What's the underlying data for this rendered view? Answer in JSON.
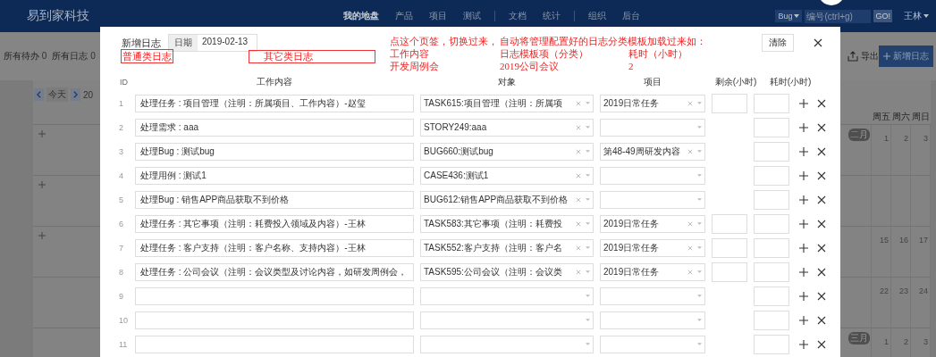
{
  "nav": {
    "logo": "易到家科技",
    "menu_groups": [
      [
        {
          "label": "我的地盘",
          "selected": true
        },
        {
          "label": "产品",
          "selected": false
        },
        {
          "label": "项目",
          "selected": false
        },
        {
          "label": "测试",
          "selected": false
        }
      ],
      [
        {
          "label": "文档",
          "selected": false
        },
        {
          "label": "统计",
          "selected": false
        }
      ],
      [
        {
          "label": "组织",
          "selected": false
        },
        {
          "label": "后台",
          "selected": false
        }
      ]
    ],
    "search": {
      "type": "Bug",
      "placeholder": "编号(ctrl+g)",
      "button": "GO!"
    },
    "user": "王林"
  },
  "subbar": {
    "tabs": [
      {
        "label": "所有待办",
        "count": "0"
      },
      {
        "label": "所有日志",
        "count": "0"
      }
    ],
    "export": "导出",
    "add": "新增日志"
  },
  "calendar": {
    "today": "今天",
    "title": "20",
    "weekdays": [
      "周五",
      "周六",
      "周日"
    ],
    "weeks": [
      {
        "month": "二月",
        "days": [
          "1",
          "2",
          "3"
        ],
        "can_add": true
      },
      {
        "can_add": true
      },
      {
        "days": [
          "15",
          "16",
          "17"
        ],
        "can_add": true
      },
      {
        "days": [
          "22",
          "23",
          "24"
        ],
        "can_add": false
      },
      {
        "month": "三月",
        "days": [
          "1",
          "2",
          "3"
        ],
        "can_add": false
      }
    ]
  },
  "modal": {
    "title": "新增日志",
    "date_label": "日期",
    "date": "2019-02-13",
    "clear": "清除",
    "annotation": {
      "tab_1": "普通类日志",
      "tab_2": "其它类日志",
      "lines": [
        [
          "点这个页签，切换过来，",
          "自动将管理配置好的日志分类模板加载过来如："
        ],
        [
          "工作内容",
          "日志模板项（分类）",
          "耗时（小时）"
        ],
        [
          "开发周例会",
          "2019公司会议",
          "2"
        ]
      ]
    },
    "columns": [
      "ID",
      "工作内容",
      "对象",
      "项目",
      "剩余(小时)",
      "耗时(小时)"
    ],
    "rows": [
      {
        "id": "1",
        "content": "处理任务 : 项目管理（注明：所属项目、工作内容）-赵玺",
        "object": "TASK615:项目管理（注明：所属项",
        "project": "2019日常任务",
        "has_remain": true
      },
      {
        "id": "2",
        "content": "处理需求 : aaa",
        "object": "STORY249:aaa",
        "has_remain": false
      },
      {
        "id": "3",
        "content": "处理Bug : 测试bug",
        "object": "BUG660:测试bug",
        "project": "第48-49周研发内容",
        "has_remain": false
      },
      {
        "id": "4",
        "content": "处理用例 : 测试1",
        "object": "CASE436:测试1",
        "has_remain": false
      },
      {
        "id": "5",
        "content": "处理Bug : 销售APP商品获取不到价格",
        "object": "BUG612:销售APP商品获取不到价格",
        "has_remain": false
      },
      {
        "id": "6",
        "content": "处理任务 : 其它事项（注明：耗费投入领域及内容）-王林",
        "object": "TASK583:其它事项（注明：耗费投",
        "project": "2019日常任务",
        "has_remain": true
      },
      {
        "id": "7",
        "content": "处理任务 : 客户支持（注明：客户名称、支持内容）-王林",
        "object": "TASK552:客户支持（注明：客户名",
        "project": "2019日常任务",
        "has_remain": true
      },
      {
        "id": "8",
        "content": "处理任务 : 公司会议（注明：会议类型及讨论内容，如研发周例会，",
        "object": "TASK595:公司会议（注明：会议类",
        "project": "2019日常任务",
        "has_remain": true
      },
      {
        "id": "9",
        "has_remain": false
      },
      {
        "id": "10",
        "has_remain": false
      },
      {
        "id": "11",
        "has_remain": false
      }
    ]
  }
}
